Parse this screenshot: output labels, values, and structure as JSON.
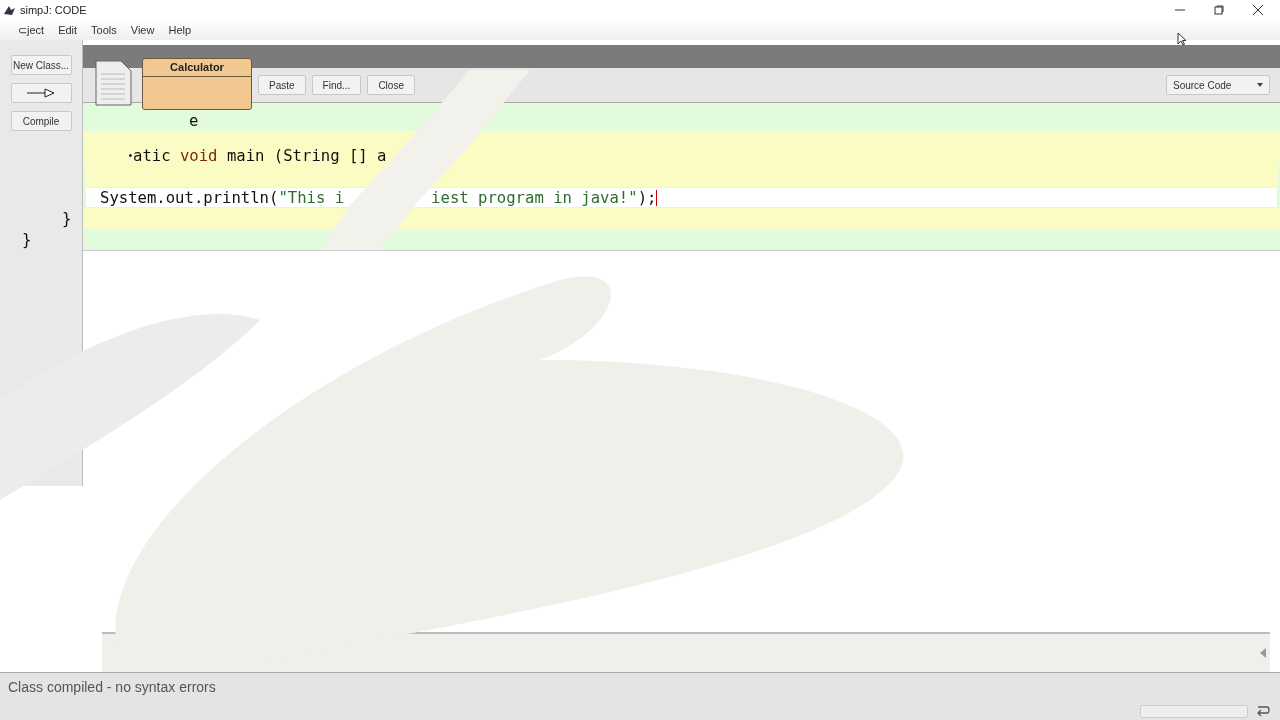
{
  "window": {
    "title": "simpJ:  CODE"
  },
  "menu": [
    "⊂ject",
    "Edit",
    "Tools",
    "View",
    "Help"
  ],
  "side_buttons": [
    {
      "kind": "text",
      "label": "New Class..."
    },
    {
      "kind": "arrow"
    },
    {
      "kind": "text",
      "label": "Compile"
    }
  ],
  "class_box": {
    "name": "Calculator"
  },
  "toolbar": {
    "buttons": [
      "Paste",
      "Find...",
      "Close"
    ],
    "view_select": "Source Code"
  },
  "code_lines": [
    {
      "kind": "class",
      "segments": [
        [
          {
            "kind": "code",
            "text": "e"
          }
        ]
      ]
    },
    {
      "kind": "method",
      "segments": [
        [
          {
            "kind": "code",
            "text": "ꞏatic "
          },
          {
            "kind": "keyword",
            "text": "void"
          },
          {
            "kind": "code",
            "text": " main (String [] a"
          }
        ]
      ]
    },
    {
      "kind": "current",
      "segments": [
        [
          {
            "kind": "code",
            "text": "System.out.println("
          },
          {
            "kind": "string",
            "text": "\"This i"
          }
        ],
        [
          {
            "kind": "string",
            "text": "iest program in java!\""
          },
          {
            "kind": "code",
            "text": ");"
          }
        ]
      ]
    },
    {
      "kind": "method",
      "segments": [
        [
          {
            "kind": "code",
            "text": "}"
          }
        ]
      ]
    },
    {
      "kind": "class",
      "segments": [
        [
          {
            "kind": "code",
            "text": "}"
          }
        ]
      ]
    }
  ],
  "status_bar": "Class compiled - no syntax errors"
}
